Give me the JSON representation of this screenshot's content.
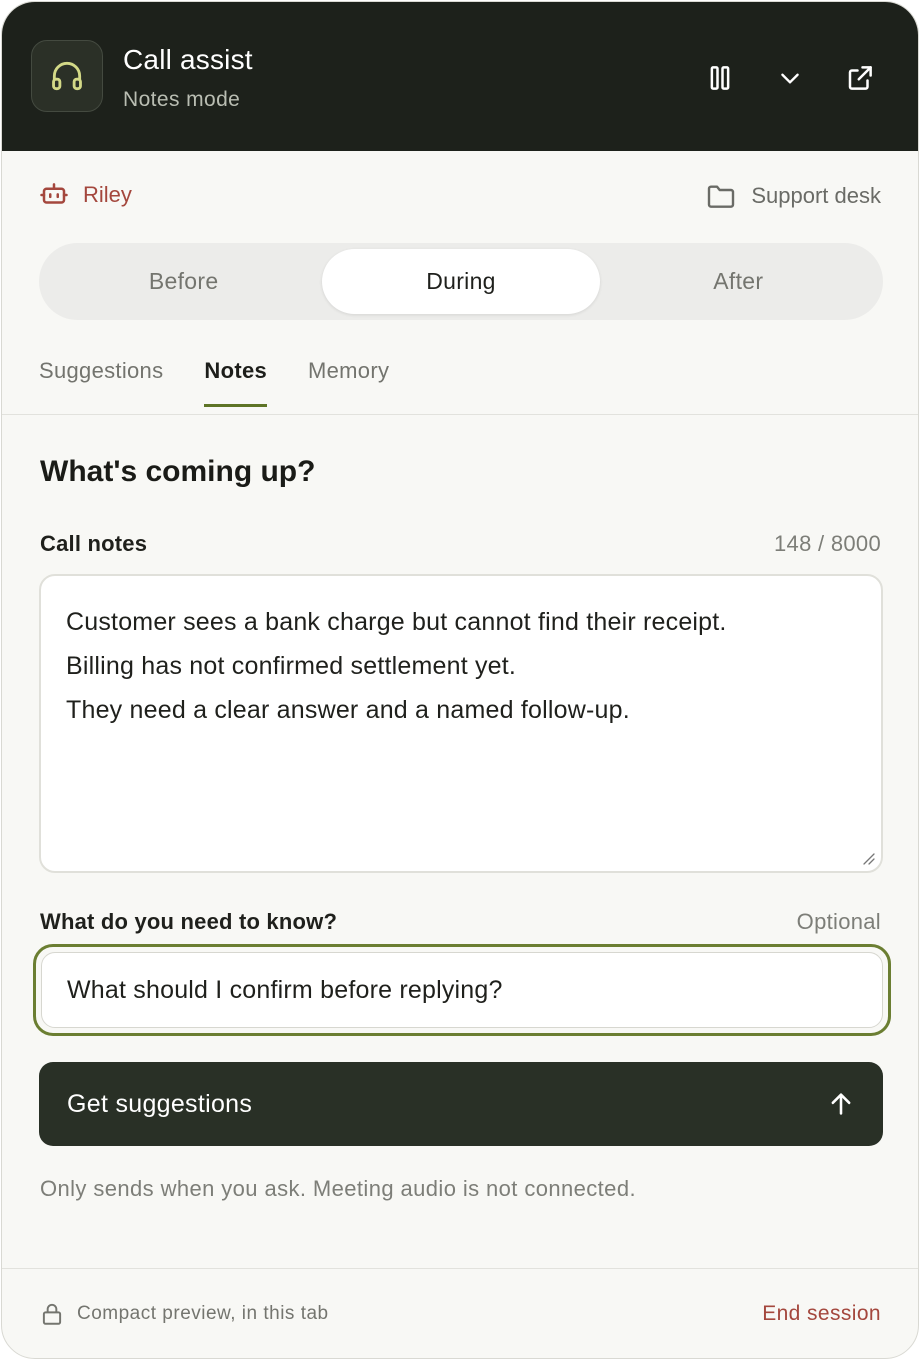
{
  "header": {
    "title": "Call assist",
    "subtitle": "Notes mode",
    "icon": "headphones-icon",
    "actions": [
      "pause-icon",
      "chevron-down-icon",
      "external-link-icon"
    ]
  },
  "meta": {
    "agent_name": "Riley",
    "agent_icon": "bot-icon",
    "workspace": "Support desk",
    "workspace_icon": "folder-icon"
  },
  "phases": [
    {
      "label": "Before"
    },
    {
      "label": "During",
      "selected": true
    },
    {
      "label": "After"
    }
  ],
  "tabs": [
    {
      "label": "Suggestions"
    },
    {
      "label": "Notes",
      "selected": true
    },
    {
      "label": "Memory"
    }
  ],
  "content": {
    "title": "What's coming up?",
    "notes": {
      "label": "Call notes",
      "count": "148 / 8000",
      "lines": [
        "Customer sees a bank charge but cannot find their receipt.",
        "Billing has not confirmed settlement yet.",
        "They need a clear answer and a named follow-up."
      ]
    },
    "question": {
      "label": "What do you need to know?",
      "hint": "Optional",
      "value": "What should I confirm before replying?"
    },
    "submit_label": "Get suggestions",
    "submit_icon": "arrow-up-icon",
    "helper": "Only sends when you ask. Meeting audio is not connected."
  },
  "footer": {
    "status": "Compact preview, in this tab",
    "status_icon": "lock-icon",
    "end_label": "End session"
  },
  "colors": {
    "header_bg": "#1d211b",
    "accent_green": "#6b7e32",
    "danger": "#a4473d",
    "button_bg": "#293026"
  }
}
